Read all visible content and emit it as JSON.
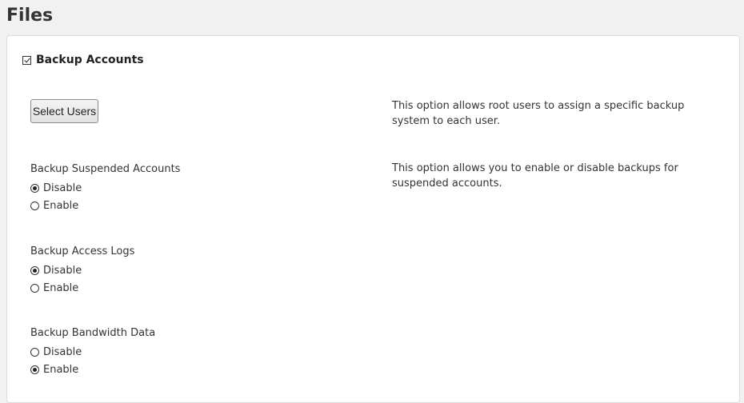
{
  "page": {
    "title": "Files"
  },
  "section": {
    "title": "Backup Accounts",
    "checked": true,
    "select_users_button": "Select Users",
    "select_users_description": "This option allows root users to assign a specific backup system to each user."
  },
  "groups": [
    {
      "label": "Backup Suspended Accounts",
      "description": "This option allows you to enable or disable backups for suspended accounts.",
      "options": [
        {
          "label": "Disable",
          "selected": true
        },
        {
          "label": "Enable",
          "selected": false
        }
      ]
    },
    {
      "label": "Backup Access Logs",
      "description": "",
      "options": [
        {
          "label": "Disable",
          "selected": true
        },
        {
          "label": "Enable",
          "selected": false
        }
      ]
    },
    {
      "label": "Backup Bandwidth Data",
      "description": "",
      "options": [
        {
          "label": "Disable",
          "selected": false
        },
        {
          "label": "Enable",
          "selected": true
        }
      ]
    }
  ]
}
